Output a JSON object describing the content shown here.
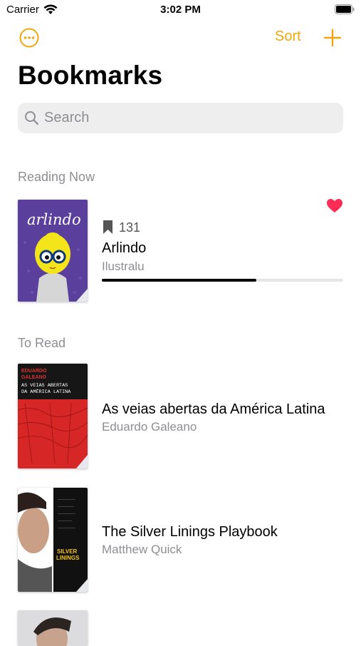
{
  "status_bar": {
    "carrier": "Carrier",
    "time": "3:02 PM"
  },
  "nav": {
    "more_icon": "ellipsis-circle-icon",
    "sort_label": "Sort",
    "add_icon": "plus-icon",
    "accent_color": "#F2A60D"
  },
  "page_title": "Bookmarks",
  "search": {
    "placeholder": "Search"
  },
  "sections": {
    "reading_now": {
      "header": "Reading Now",
      "books": [
        {
          "title": "Arlindo",
          "author": "Ilustralu",
          "bookmark_page": "131",
          "favorite": true,
          "progress": 0.64,
          "cover_text": "arlindo"
        }
      ]
    },
    "to_read": {
      "header": "To Read",
      "books": [
        {
          "title": "As veias abertas da América Latina",
          "author": "Eduardo Galeano",
          "cover_text": [
            "EDUARDO",
            "GALEANO",
            "AS VEIAS ABERTAS",
            "DA AMÉRICA LATINA"
          ]
        },
        {
          "title": "The Silver Linings Playbook",
          "author": "Matthew Quick",
          "cover_text": [
            "SILVER",
            "LININGS"
          ]
        }
      ]
    }
  },
  "colors": {
    "favorite_heart": "#FF2D55",
    "secondary_text": "#8E8E93",
    "progress_fill": "#000000"
  }
}
